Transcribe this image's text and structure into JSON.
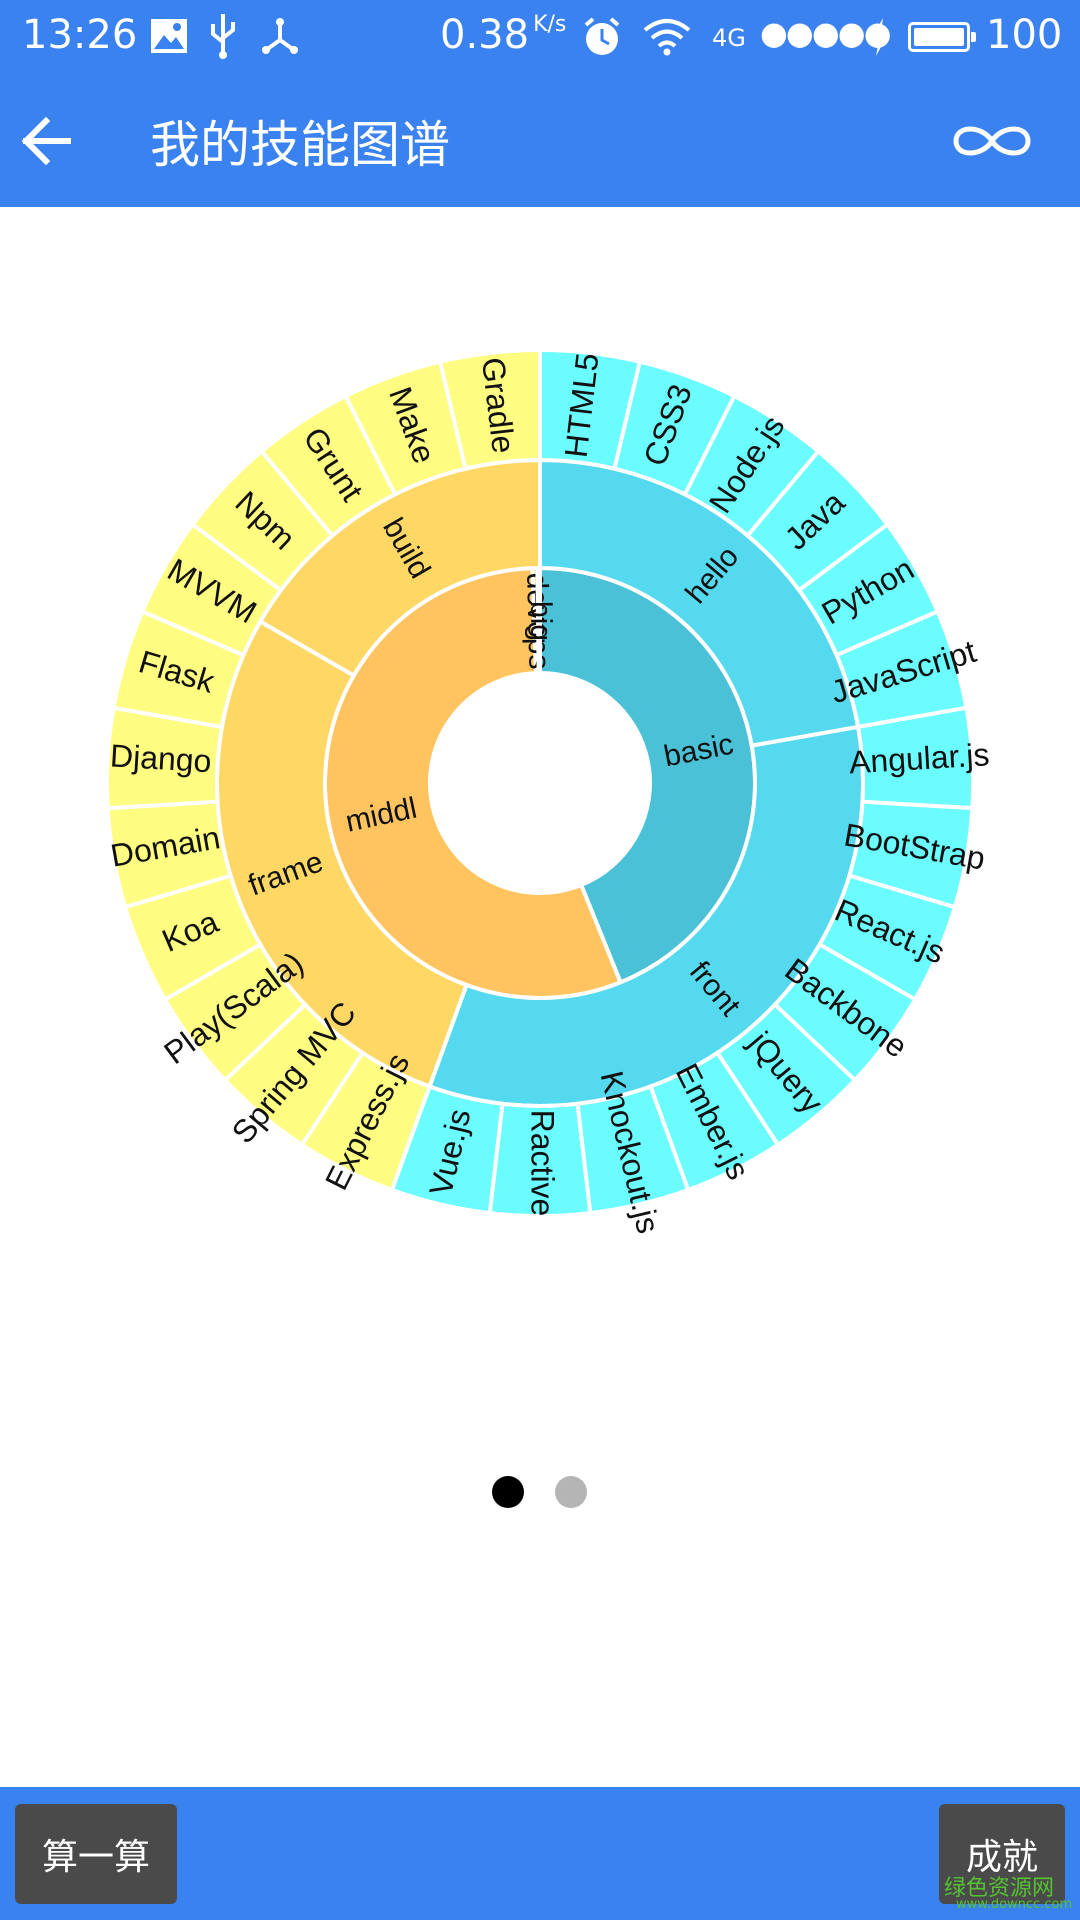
{
  "status": {
    "time": "13:26",
    "speed": "0.38",
    "speed_unit": "K/s",
    "network": "4G",
    "battery": "100"
  },
  "appbar": {
    "title": "我的技能图谱"
  },
  "icons": {
    "back": "arrow-left-icon",
    "more": "infinity-icon"
  },
  "colors": {
    "brand": "#3a82f0",
    "inner_blue": "#4ac1d6",
    "inner_orange": "#ffc45f",
    "mid_blue": "#55d9ee",
    "mid_orange": "#ffd764",
    "outer_cyan": "#6bfcff",
    "outer_yellow": "#fffc82"
  },
  "chart_data": {
    "type": "sunburst",
    "inner": [
      {
        "label": "basic",
        "start": 0,
        "end": 158,
        "color": "#4ac1d6"
      },
      {
        "label": "middl",
        "start": 158,
        "end": 358,
        "color": "#ffc45f"
      },
      {
        "label": "devops",
        "start": 358,
        "end": 359.3,
        "color": "#ffc45f"
      },
      {
        "label": "big",
        "start": 359.3,
        "end": 360,
        "color": "#4ac1d6"
      }
    ],
    "middle": [
      {
        "label": "hello",
        "start": 0,
        "end": 80,
        "color": "#55d9ee"
      },
      {
        "label": "front",
        "start": 80,
        "end": 200,
        "color": "#55d9ee"
      },
      {
        "label": "frame",
        "start": 200,
        "end": 300,
        "color": "#ffd764"
      },
      {
        "label": "build",
        "start": 300,
        "end": 360,
        "color": "#ffd764"
      }
    ],
    "outer": [
      {
        "label": "HTML5",
        "color": "#6bfcff"
      },
      {
        "label": "CSS3",
        "color": "#6bfcff"
      },
      {
        "label": "Node.js",
        "color": "#6bfcff"
      },
      {
        "label": "Java",
        "color": "#6bfcff"
      },
      {
        "label": "Python",
        "color": "#6bfcff"
      },
      {
        "label": "JavaScript",
        "color": "#6bfcff"
      },
      {
        "label": "Angular.js",
        "color": "#6bfcff"
      },
      {
        "label": "BootStrap",
        "color": "#6bfcff"
      },
      {
        "label": "React.js",
        "color": "#6bfcff"
      },
      {
        "label": "Backbone",
        "color": "#6bfcff"
      },
      {
        "label": "jQuery",
        "color": "#6bfcff"
      },
      {
        "label": "Ember.js",
        "color": "#6bfcff"
      },
      {
        "label": "Knockout.js",
        "color": "#6bfcff"
      },
      {
        "label": "Ractive",
        "color": "#6bfcff"
      },
      {
        "label": "Vue.js",
        "color": "#6bfcff"
      },
      {
        "label": "Express.js",
        "color": "#fffc82"
      },
      {
        "label": "Spring MVC",
        "color": "#fffc82"
      },
      {
        "label": "Play(Scala)",
        "color": "#fffc82"
      },
      {
        "label": "Koa",
        "color": "#fffc82"
      },
      {
        "label": "Domain",
        "color": "#fffc82"
      },
      {
        "label": "Django",
        "color": "#fffc82"
      },
      {
        "label": "Flask",
        "color": "#fffc82"
      },
      {
        "label": "MVVM",
        "color": "#fffc82"
      },
      {
        "label": "Npm",
        "color": "#fffc82"
      },
      {
        "label": "Grunt",
        "color": "#fffc82"
      },
      {
        "label": "Make",
        "color": "#fffc82"
      },
      {
        "label": "Gradle",
        "color": "#fffc82"
      }
    ]
  },
  "pager": {
    "pages": 2,
    "active": 1
  },
  "bottom": {
    "left_button": "算一算",
    "right_button": "成就"
  },
  "watermark": {
    "text": "绿色资源网",
    "url": "www.downcc.com"
  }
}
